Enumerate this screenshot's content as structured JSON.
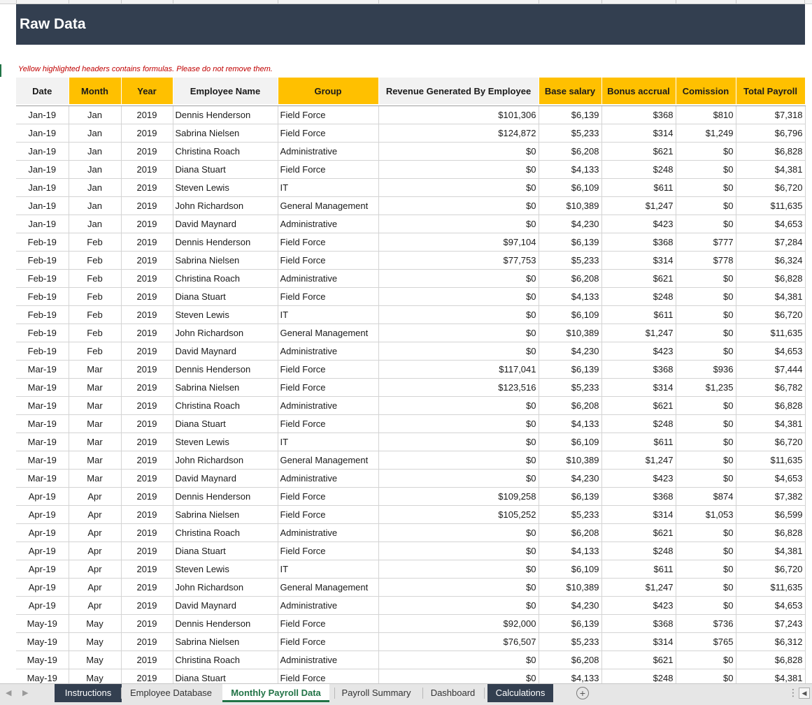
{
  "sheet": {
    "title": "Raw Data",
    "note": "Yellow highlighted headers contains formulas. Please do not remove them.",
    "colors": {
      "title_bg": "#333f50",
      "formula_header": "#ffc000",
      "plain_header": "#f2f2f2",
      "note": "#c00000",
      "active_tab": "#217346"
    }
  },
  "table": {
    "headers": [
      {
        "label": "Date",
        "formula": false
      },
      {
        "label": "Month",
        "formula": true
      },
      {
        "label": "Year",
        "formula": true
      },
      {
        "label": "Employee Name",
        "formula": false
      },
      {
        "label": "Group",
        "formula": true
      },
      {
        "label": "Revenue Generated By Employee",
        "formula": false
      },
      {
        "label": "Base salary",
        "formula": true
      },
      {
        "label": "Bonus accrual",
        "formula": true
      },
      {
        "label": "Comission",
        "formula": true
      },
      {
        "label": "Total Payroll",
        "formula": true
      }
    ],
    "rows": [
      [
        "Jan-19",
        "Jan",
        "2019",
        "Dennis Henderson",
        "Field Force",
        "$101,306",
        "$6,139",
        "$368",
        "$810",
        "$7,318"
      ],
      [
        "Jan-19",
        "Jan",
        "2019",
        "Sabrina Nielsen",
        "Field Force",
        "$124,872",
        "$5,233",
        "$314",
        "$1,249",
        "$6,796"
      ],
      [
        "Jan-19",
        "Jan",
        "2019",
        "Christina Roach",
        "Administrative",
        "$0",
        "$6,208",
        "$621",
        "$0",
        "$6,828"
      ],
      [
        "Jan-19",
        "Jan",
        "2019",
        "Diana Stuart",
        "Field Force",
        "$0",
        "$4,133",
        "$248",
        "$0",
        "$4,381"
      ],
      [
        "Jan-19",
        "Jan",
        "2019",
        "Steven Lewis",
        "IT",
        "$0",
        "$6,109",
        "$611",
        "$0",
        "$6,720"
      ],
      [
        "Jan-19",
        "Jan",
        "2019",
        "John Richardson",
        "General Management",
        "$0",
        "$10,389",
        "$1,247",
        "$0",
        "$11,635"
      ],
      [
        "Jan-19",
        "Jan",
        "2019",
        "David Maynard",
        "Administrative",
        "$0",
        "$4,230",
        "$423",
        "$0",
        "$4,653"
      ],
      [
        "Feb-19",
        "Feb",
        "2019",
        "Dennis Henderson",
        "Field Force",
        "$97,104",
        "$6,139",
        "$368",
        "$777",
        "$7,284"
      ],
      [
        "Feb-19",
        "Feb",
        "2019",
        "Sabrina Nielsen",
        "Field Force",
        "$77,753",
        "$5,233",
        "$314",
        "$778",
        "$6,324"
      ],
      [
        "Feb-19",
        "Feb",
        "2019",
        "Christina Roach",
        "Administrative",
        "$0",
        "$6,208",
        "$621",
        "$0",
        "$6,828"
      ],
      [
        "Feb-19",
        "Feb",
        "2019",
        "Diana Stuart",
        "Field Force",
        "$0",
        "$4,133",
        "$248",
        "$0",
        "$4,381"
      ],
      [
        "Feb-19",
        "Feb",
        "2019",
        "Steven Lewis",
        "IT",
        "$0",
        "$6,109",
        "$611",
        "$0",
        "$6,720"
      ],
      [
        "Feb-19",
        "Feb",
        "2019",
        "John Richardson",
        "General Management",
        "$0",
        "$10,389",
        "$1,247",
        "$0",
        "$11,635"
      ],
      [
        "Feb-19",
        "Feb",
        "2019",
        "David Maynard",
        "Administrative",
        "$0",
        "$4,230",
        "$423",
        "$0",
        "$4,653"
      ],
      [
        "Mar-19",
        "Mar",
        "2019",
        "Dennis Henderson",
        "Field Force",
        "$117,041",
        "$6,139",
        "$368",
        "$936",
        "$7,444"
      ],
      [
        "Mar-19",
        "Mar",
        "2019",
        "Sabrina Nielsen",
        "Field Force",
        "$123,516",
        "$5,233",
        "$314",
        "$1,235",
        "$6,782"
      ],
      [
        "Mar-19",
        "Mar",
        "2019",
        "Christina Roach",
        "Administrative",
        "$0",
        "$6,208",
        "$621",
        "$0",
        "$6,828"
      ],
      [
        "Mar-19",
        "Mar",
        "2019",
        "Diana Stuart",
        "Field Force",
        "$0",
        "$4,133",
        "$248",
        "$0",
        "$4,381"
      ],
      [
        "Mar-19",
        "Mar",
        "2019",
        "Steven Lewis",
        "IT",
        "$0",
        "$6,109",
        "$611",
        "$0",
        "$6,720"
      ],
      [
        "Mar-19",
        "Mar",
        "2019",
        "John Richardson",
        "General Management",
        "$0",
        "$10,389",
        "$1,247",
        "$0",
        "$11,635"
      ],
      [
        "Mar-19",
        "Mar",
        "2019",
        "David Maynard",
        "Administrative",
        "$0",
        "$4,230",
        "$423",
        "$0",
        "$4,653"
      ],
      [
        "Apr-19",
        "Apr",
        "2019",
        "Dennis Henderson",
        "Field Force",
        "$109,258",
        "$6,139",
        "$368",
        "$874",
        "$7,382"
      ],
      [
        "Apr-19",
        "Apr",
        "2019",
        "Sabrina Nielsen",
        "Field Force",
        "$105,252",
        "$5,233",
        "$314",
        "$1,053",
        "$6,599"
      ],
      [
        "Apr-19",
        "Apr",
        "2019",
        "Christina Roach",
        "Administrative",
        "$0",
        "$6,208",
        "$621",
        "$0",
        "$6,828"
      ],
      [
        "Apr-19",
        "Apr",
        "2019",
        "Diana Stuart",
        "Field Force",
        "$0",
        "$4,133",
        "$248",
        "$0",
        "$4,381"
      ],
      [
        "Apr-19",
        "Apr",
        "2019",
        "Steven Lewis",
        "IT",
        "$0",
        "$6,109",
        "$611",
        "$0",
        "$6,720"
      ],
      [
        "Apr-19",
        "Apr",
        "2019",
        "John Richardson",
        "General Management",
        "$0",
        "$10,389",
        "$1,247",
        "$0",
        "$11,635"
      ],
      [
        "Apr-19",
        "Apr",
        "2019",
        "David Maynard",
        "Administrative",
        "$0",
        "$4,230",
        "$423",
        "$0",
        "$4,653"
      ],
      [
        "May-19",
        "May",
        "2019",
        "Dennis Henderson",
        "Field Force",
        "$92,000",
        "$6,139",
        "$368",
        "$736",
        "$7,243"
      ],
      [
        "May-19",
        "May",
        "2019",
        "Sabrina Nielsen",
        "Field Force",
        "$76,507",
        "$5,233",
        "$314",
        "$765",
        "$6,312"
      ],
      [
        "May-19",
        "May",
        "2019",
        "Christina Roach",
        "Administrative",
        "$0",
        "$6,208",
        "$621",
        "$0",
        "$6,828"
      ],
      [
        "May-19",
        "May",
        "2019",
        "Diana Stuart",
        "Field Force",
        "$0",
        "$4,133",
        "$248",
        "$0",
        "$4,381"
      ]
    ]
  },
  "tabs": {
    "items": [
      {
        "label": "Instructions",
        "style": "dark"
      },
      {
        "label": "Employee Database",
        "style": "plain"
      },
      {
        "label": "Monthly Payroll Data",
        "style": "active"
      },
      {
        "label": "Payroll Summary",
        "style": "plain"
      },
      {
        "label": "Dashboard",
        "style": "plain"
      },
      {
        "label": "Calculations",
        "style": "dark"
      }
    ],
    "add_symbol": "+",
    "more_symbol": "⋮",
    "nav_prev": "◀",
    "nav_next": "▶",
    "scroll_left": "◀"
  }
}
